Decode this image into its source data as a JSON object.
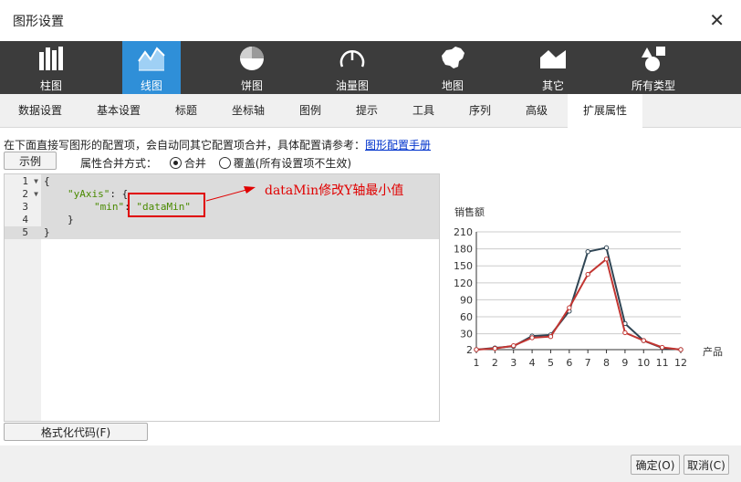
{
  "window": {
    "title": "图形设置",
    "close_glyph": "✕"
  },
  "chart_types": [
    {
      "label": "柱图",
      "icon": "bar-chart-icon"
    },
    {
      "label": "线图",
      "icon": "line-chart-icon",
      "active": true
    },
    {
      "label": "饼图",
      "icon": "pie-chart-icon"
    },
    {
      "label": "油量图",
      "icon": "gauge-icon"
    },
    {
      "label": "地图",
      "icon": "map-icon"
    },
    {
      "label": "其它",
      "icon": "area-chart-icon"
    },
    {
      "label": "所有类型",
      "icon": "shapes-icon"
    }
  ],
  "tabs": [
    "数据设置",
    "基本设置",
    "标题",
    "坐标轴",
    "图例",
    "提示",
    "工具",
    "序列",
    "高级",
    "扩展属性"
  ],
  "active_tab": "扩展属性",
  "info": {
    "text": "在下面直接写图形的配置项，会自动同其它配置项合并，具体配置请参考：",
    "link": "图形配置手册"
  },
  "example_button": "示例",
  "merge": {
    "label": "属性合并方式：",
    "option_merge": "合并",
    "option_override": "覆盖(所有设置项不生效)",
    "selected": "合并"
  },
  "editor": {
    "line_numbers": [
      "1",
      "2",
      "3",
      "4",
      "5"
    ],
    "code": {
      "l1": "{",
      "l2_key": "\"yAxis\"",
      "l2_rest": ": {",
      "l3_key": "\"min\"",
      "l3_colon": ": ",
      "l3_val": "\"dataMin\"",
      "l4": "}",
      "l5": "}"
    }
  },
  "annotation": "dataMin修改Y轴最小值",
  "format_button": "格式化代码(F)",
  "ok_button": "确定(O)",
  "cancel_button": "取消(C)",
  "colors": {
    "accent": "#2f8fd8",
    "toolbar_bg": "#3c3c3c",
    "series_dark": "#2f4554",
    "series_red": "#c23531",
    "annotation": "#e00000"
  },
  "chart_data": {
    "type": "line",
    "ylabel": "销售额",
    "xlabel": "产品",
    "categories": [
      "1",
      "2",
      "3",
      "4",
      "5",
      "6",
      "7",
      "8",
      "9",
      "10",
      "11",
      "12"
    ],
    "yticks": [
      2,
      30,
      60,
      90,
      120,
      150,
      180,
      210
    ],
    "ylim": [
      2,
      210
    ],
    "grid": true,
    "series": [
      {
        "values": [
          2,
          5,
          8,
          26,
          28,
          70,
          175,
          182,
          48,
          18,
          5,
          2
        ],
        "color": "#2f4554"
      },
      {
        "values": [
          2,
          4,
          9,
          23,
          25,
          76,
          135,
          162,
          32,
          18,
          6,
          2
        ],
        "color": "#c23531"
      }
    ]
  }
}
